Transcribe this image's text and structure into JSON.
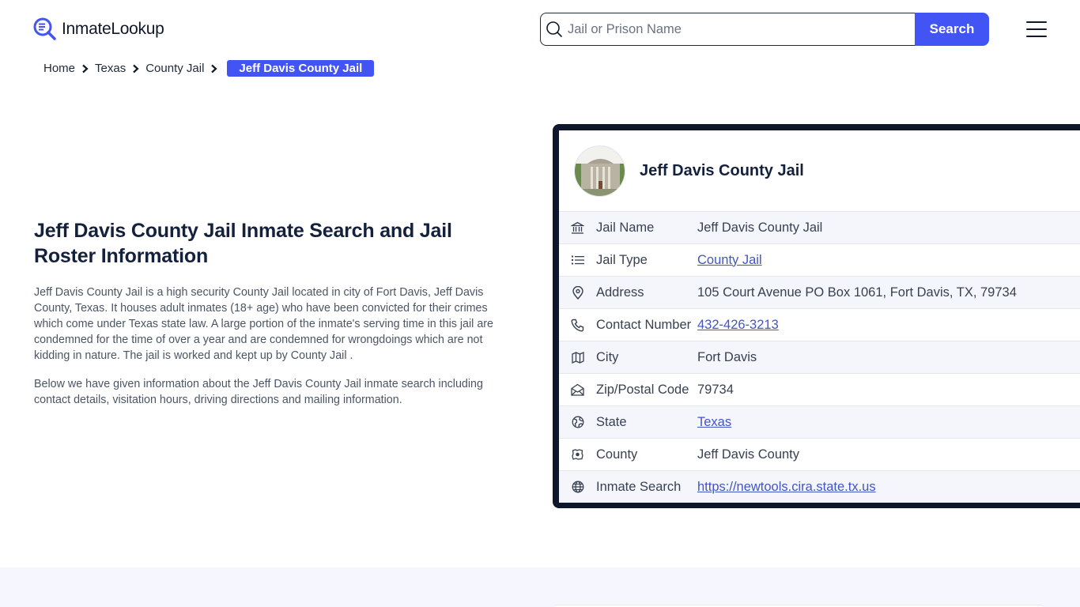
{
  "header": {
    "logo_text": "InmateLookup",
    "logo_icon": "magnifier-doc-icon",
    "search": {
      "placeholder": "Jail or Prison Name",
      "value": "",
      "button_label": "Search"
    },
    "menu_icon": "hamburger-icon"
  },
  "breadcrumb": {
    "items": [
      "Home",
      "Texas",
      "County Jail"
    ],
    "current": "Jeff Davis County Jail"
  },
  "intro": {
    "title": "Jeff Davis County Jail Inmate Search and Jail Roster Information",
    "paragraphs": [
      "Jeff Davis County Jail is a high security County Jail located in city of Fort Davis, Jeff Davis County, Texas. It houses adult inmates (18+ age) who have been convicted for their crimes which come under Texas state law. A large portion of the inmate's serving time in this jail are condemned for the time of over a year and are condemned for wrongdoings which are not kidding in nature. The jail is worked and kept up by County Jail .",
      "Below we have given information about the Jeff Davis County Jail inmate search including contact details, visitation hours, driving directions and mailing information."
    ]
  },
  "card": {
    "title": "Jeff Davis County Jail",
    "avatar_alt": "Jeff Davis County Courthouse photo",
    "rows": [
      {
        "icon": "building-columns-icon",
        "label": "Jail Name",
        "value": "Jeff Davis County Jail",
        "link": false
      },
      {
        "icon": "list-icon",
        "label": "Jail Type",
        "value": "County Jail",
        "link": true
      },
      {
        "icon": "map-pin-icon",
        "label": "Address",
        "value": "105 Court Avenue PO Box 1061, Fort Davis, TX, 79734",
        "link": false
      },
      {
        "icon": "phone-icon",
        "label": "Contact Number",
        "value": "432-426-3213",
        "link": true
      },
      {
        "icon": "map-icon",
        "label": "City",
        "value": "Fort Davis",
        "link": false
      },
      {
        "icon": "mail-open-icon",
        "label": "Zip/Postal Code",
        "value": "79734",
        "link": false
      },
      {
        "icon": "globe-pin-icon",
        "label": "State",
        "value": "Texas",
        "link": true
      },
      {
        "icon": "county-map-icon",
        "label": "County",
        "value": "Jeff Davis County",
        "link": false
      },
      {
        "icon": "globe-icon",
        "label": "Inmate Search",
        "value": "https://newtools.cira.state.tx.us",
        "link": true
      }
    ]
  },
  "colors": {
    "accent": "#4354f5",
    "card_border": "#0f172a",
    "link": "#4354c5",
    "heading": "#14213d",
    "alt_row": "#f5f6fc"
  }
}
